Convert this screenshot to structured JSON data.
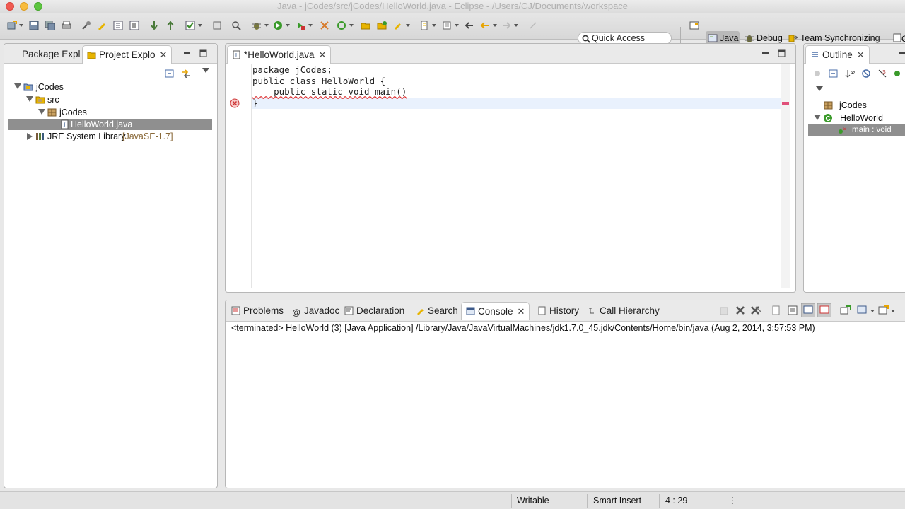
{
  "window": {
    "title": "Java - jCodes/src/jCodes/HelloWorld.java - Eclipse - /Users/CJ/Documents/workspace"
  },
  "toolbar": {
    "quick_access_label": "Quick Access",
    "perspectives": [
      {
        "label": "Java",
        "icon": "java-perspective-icon",
        "active": true
      },
      {
        "label": "Debug",
        "icon": "debug-perspective-icon"
      },
      {
        "label": "Team Synchronizing",
        "icon": "team-sync-icon"
      }
    ]
  },
  "explorer": {
    "tabs": [
      {
        "label": "Package Expl",
        "icon": "package-explorer-icon"
      },
      {
        "label": "Project Explo",
        "icon": "project-explorer-icon",
        "active": true
      }
    ],
    "tree": [
      {
        "label": "jCodes",
        "icon": "project-icon",
        "expanded": true
      },
      {
        "label": "src",
        "icon": "source-folder-icon",
        "expanded": true
      },
      {
        "label": "jCodes",
        "icon": "package-icon",
        "expanded": true
      },
      {
        "label": "HelloWorld.java",
        "icon": "java-file-icon",
        "selected": true
      },
      {
        "label": "JRE System Library",
        "suffix": "[JavaSE-1.7]",
        "icon": "library-icon",
        "expanded": false
      }
    ]
  },
  "editor": {
    "tab_label": "*HelloWorld.java",
    "lines": [
      "package jCodes;",
      "",
      "public class HelloWorld {",
      "    public static void main()",
      "}"
    ],
    "error_line": 4
  },
  "outline": {
    "tab_label": "Outline",
    "items": [
      {
        "label": "jCodes",
        "icon": "package-icon"
      },
      {
        "label": "HelloWorld",
        "icon": "class-icon",
        "expanded": true
      },
      {
        "label": "main : void",
        "icon": "method-icon",
        "selected": true
      }
    ]
  },
  "bottom": {
    "tabs": [
      {
        "label": "Problems",
        "icon": "problems-icon"
      },
      {
        "label": "Javadoc",
        "icon": "javadoc-icon"
      },
      {
        "label": "Declaration",
        "icon": "declaration-icon"
      },
      {
        "label": "Search",
        "icon": "search-view-icon"
      },
      {
        "label": "Console",
        "icon": "console-icon",
        "active": true
      },
      {
        "label": "History",
        "icon": "history-icon"
      },
      {
        "label": "Call Hierarchy",
        "icon": "call-hierarchy-icon"
      }
    ],
    "console_text": "<terminated> HelloWorld (3) [Java Application] /Library/Java/JavaVirtualMachines/jdk1.7.0_45.jdk/Contents/Home/bin/java (Aug 2, 2014, 3:57:53 PM)"
  },
  "status": {
    "writable": "Writable",
    "insert_mode": "Smart Insert",
    "cursor_position": "4 : 29"
  },
  "colors": {
    "selection": "#8f8f8f",
    "current_line": "#e9f1fd",
    "error": "#d9534f"
  }
}
